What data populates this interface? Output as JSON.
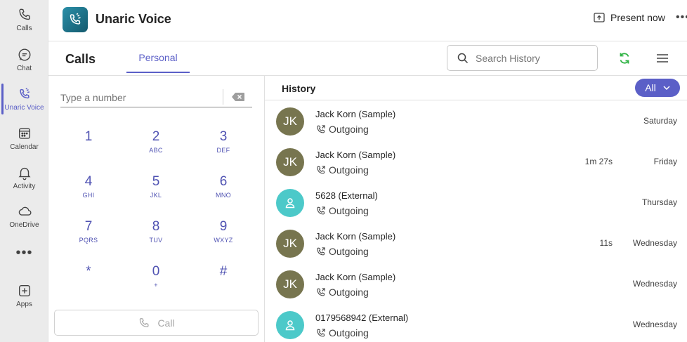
{
  "rail": {
    "items": [
      {
        "label": "Calls",
        "icon": "phone-icon"
      },
      {
        "label": "Chat",
        "icon": "chat-icon"
      },
      {
        "label": "Unaric Voice",
        "icon": "unaric-voice-icon"
      },
      {
        "label": "Calendar",
        "icon": "calendar-icon"
      },
      {
        "label": "Activity",
        "icon": "bell-icon"
      },
      {
        "label": "OneDrive",
        "icon": "cloud-icon"
      },
      {
        "label": "Apps",
        "icon": "add-apps-icon"
      }
    ],
    "more": "•••"
  },
  "header": {
    "app_title": "Unaric Voice",
    "present_label": "Present now",
    "more": "•••"
  },
  "subheader": {
    "title": "Calls",
    "tab_personal": "Personal",
    "search_placeholder": "Search History"
  },
  "dialpad": {
    "number_placeholder": "Type a number",
    "keys": [
      {
        "digit": "1",
        "letters": ""
      },
      {
        "digit": "2",
        "letters": "ABC"
      },
      {
        "digit": "3",
        "letters": "DEF"
      },
      {
        "digit": "4",
        "letters": "GHI"
      },
      {
        "digit": "5",
        "letters": "JKL"
      },
      {
        "digit": "6",
        "letters": "MNO"
      },
      {
        "digit": "7",
        "letters": "PQRS"
      },
      {
        "digit": "8",
        "letters": "TUV"
      },
      {
        "digit": "9",
        "letters": "WXYZ"
      },
      {
        "digit": "*",
        "letters": ""
      },
      {
        "digit": "0",
        "letters": "+"
      },
      {
        "digit": "#",
        "letters": ""
      }
    ],
    "call_label": "Call"
  },
  "history": {
    "title": "History",
    "filter_label": "All",
    "rows": [
      {
        "initials": "JK",
        "name": "Jack Korn (Sample)",
        "direction": "Outgoing",
        "duration": "",
        "day": "Saturday",
        "avatar_color": "#77754f"
      },
      {
        "initials": "JK",
        "name": "Jack Korn (Sample)",
        "direction": "Outgoing",
        "duration": "1m 27s",
        "day": "Friday",
        "avatar_color": "#77754f"
      },
      {
        "initials": "",
        "name": "5628 (External)",
        "direction": "Outgoing",
        "duration": "",
        "day": "Thursday",
        "avatar_color": "#4cc9c9"
      },
      {
        "initials": "JK",
        "name": "Jack Korn (Sample)",
        "direction": "Outgoing",
        "duration": "11s",
        "day": "Wednesday",
        "avatar_color": "#77754f"
      },
      {
        "initials": "JK",
        "name": "Jack Korn (Sample)",
        "direction": "Outgoing",
        "duration": "",
        "day": "Wednesday",
        "avatar_color": "#77754f"
      },
      {
        "initials": "",
        "name": "0179568942 (External)",
        "direction": "Outgoing",
        "duration": "",
        "day": "Wednesday",
        "avatar_color": "#4cc9c9"
      }
    ]
  },
  "colors": {
    "accent": "#5b5fc7",
    "dial_digit": "#4f52b2",
    "refresh": "#2fb344"
  }
}
